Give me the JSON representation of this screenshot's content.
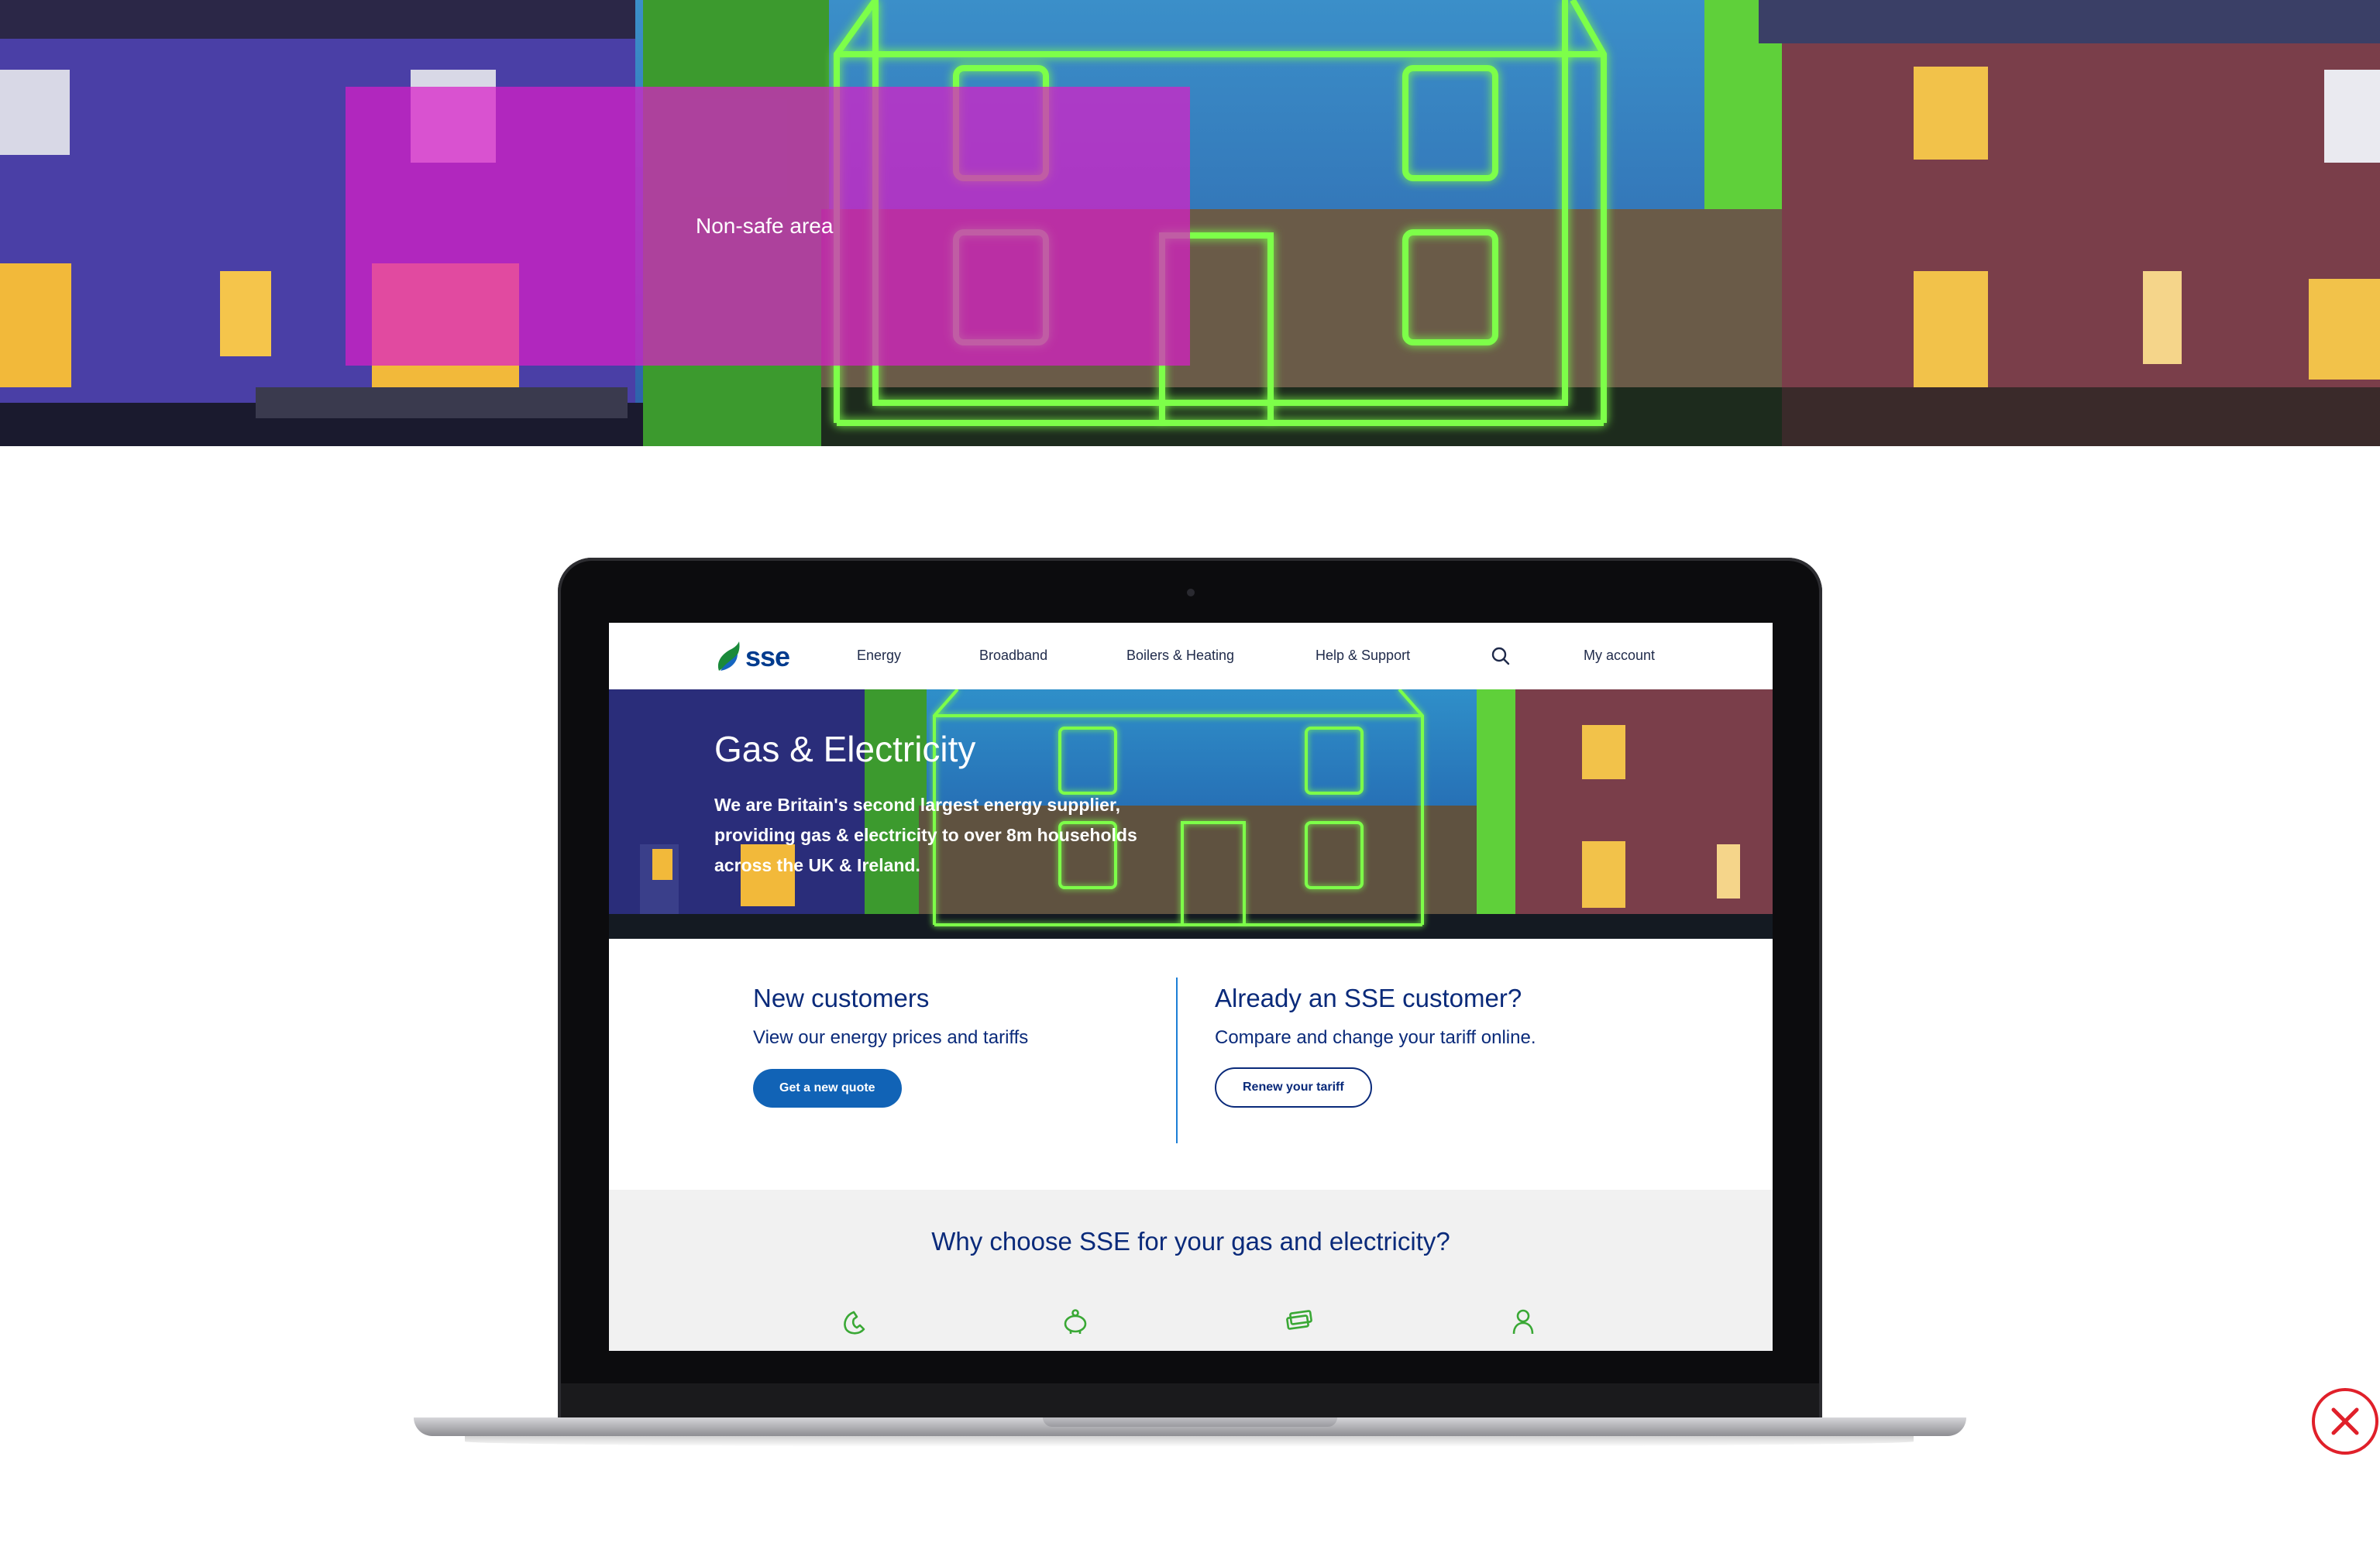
{
  "banner": {
    "nonsafe_label": "Non-safe area"
  },
  "site": {
    "logo_text": "sse",
    "nav": {
      "energy": "Energy",
      "broadband": "Broadband",
      "boilers": "Boilers & Heating",
      "help": "Help & Support",
      "account": "My account"
    },
    "hero": {
      "title": "Gas & Electricity",
      "desc_line1": "We are Britain's second largest energy supplier,",
      "desc_line2": "providing gas & electricity to over 8m households",
      "desc_line3": "across the UK & Ireland."
    },
    "new_customers": {
      "title": "New customers",
      "subtitle": "View our energy prices and tariffs",
      "button": "Get a new quote"
    },
    "existing_customers": {
      "title": "Already an SSE customer?",
      "subtitle": "Compare and change your tariff online.",
      "button": "Renew your tariff"
    },
    "why": {
      "title": "Why choose SSE for your gas and electricity?",
      "icons": [
        "phone-icon",
        "piggy-bank-icon",
        "money-icon",
        "person-icon"
      ]
    }
  },
  "colors": {
    "brand_navy": "#0a2a7a",
    "brand_blue": "#1163b6",
    "neon_green": "#6dff3a",
    "nonsafe_magenta": "#d91fc8",
    "close_red": "#e0202a"
  }
}
